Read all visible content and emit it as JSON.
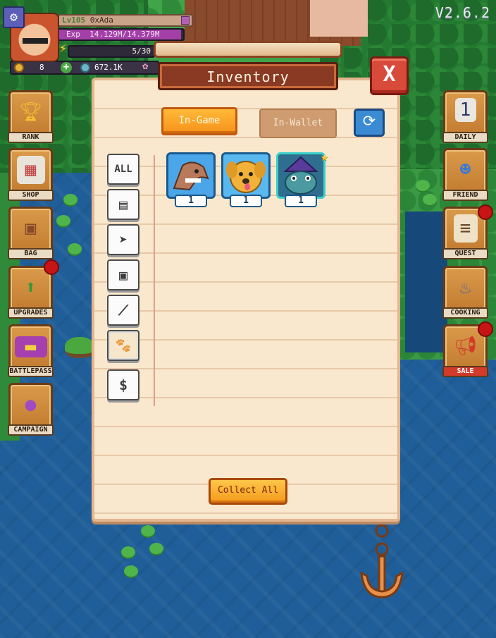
{
  "version": "V2.6.2",
  "player": {
    "level": "Lv105",
    "name": "0xAda",
    "exp_label": "Exp",
    "exp_text": "14.129M/14.379M",
    "exp_fraction": 0.983,
    "energy_text": "5/30",
    "gold": "8",
    "gems": "672.1K"
  },
  "left_menu": [
    {
      "label": "RANK",
      "icon": "trophy-icon"
    },
    {
      "label": "SHOP",
      "icon": "shop-icon"
    },
    {
      "label": "BAG",
      "icon": "backpack-icon"
    },
    {
      "label": "UPGRADES",
      "icon": "upgrade-arrow-icon",
      "notification": true
    },
    {
      "label": "BATTLEPASS",
      "icon": "ticket-icon"
    },
    {
      "label": "CAMPAIGN",
      "icon": "balloon-icon"
    }
  ],
  "right_menu": [
    {
      "label": "DAILY",
      "icon": "calendar-icon"
    },
    {
      "label": "FRIEND",
      "icon": "friend-icon"
    },
    {
      "label": "QUEST",
      "icon": "scroll-icon",
      "notification": true
    },
    {
      "label": "COOKING",
      "icon": "cooking-pot-icon"
    },
    {
      "label": "SALE",
      "icon": "megaphone-icon",
      "notification": true
    }
  ],
  "inventory": {
    "title": "Inventory",
    "close_label": "X",
    "tabs": {
      "in_game": "In-Game",
      "in_wallet": "In-Wallet",
      "active": "in_game"
    },
    "categories": [
      {
        "id": "all",
        "label": "ALL",
        "icon": "all-icon"
      },
      {
        "id": "chest",
        "label": "",
        "icon": "chest-icon"
      },
      {
        "id": "fish",
        "label": "",
        "icon": "fish-icon"
      },
      {
        "id": "locked-chest",
        "label": "",
        "icon": "locked-chest-icon"
      },
      {
        "id": "fishing-rod",
        "label": "",
        "icon": "fishing-rod-icon"
      },
      {
        "id": "pets",
        "label": "",
        "icon": "paw-icon",
        "active": true
      },
      {
        "id": "currency",
        "label": "$",
        "icon": "dollar-icon"
      }
    ],
    "items": [
      {
        "name": "shark-pet",
        "count": "1",
        "bg": "#4aa6e8"
      },
      {
        "name": "dog-pet",
        "count": "1",
        "bg": "#5ab8f0"
      },
      {
        "name": "frog-wizard-pet",
        "count": "1",
        "bg": "#2f6e8e",
        "starred": true
      }
    ],
    "collect_all_label": "Collect All"
  }
}
